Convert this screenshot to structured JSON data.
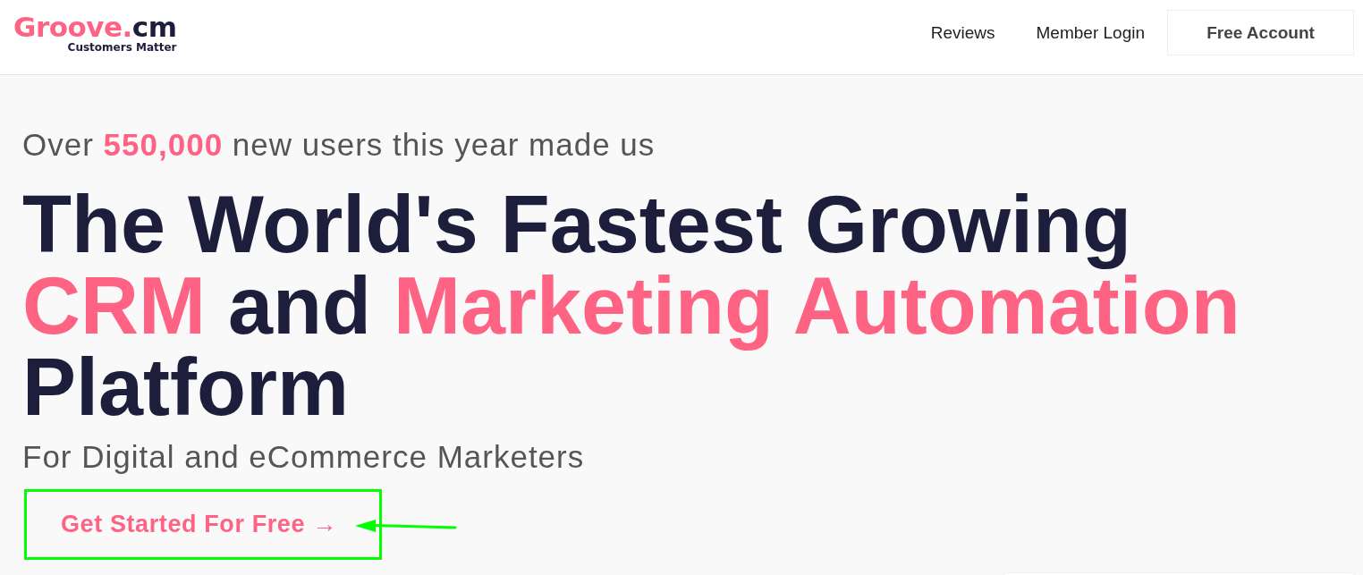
{
  "header": {
    "logo": {
      "wordmark": [
        {
          "text": "Groove.",
          "accent": true
        },
        {
          "text": "cm",
          "accent": false
        }
      ],
      "tagline": "Customers Matter"
    },
    "nav": [
      {
        "label": "Reviews",
        "kind": "link"
      },
      {
        "label": "Member Login",
        "kind": "link"
      },
      {
        "label": "Free Account",
        "kind": "button"
      }
    ]
  },
  "hero": {
    "intro": [
      {
        "text": "Over ",
        "accent": false
      },
      {
        "text": "550,000",
        "accent": true
      },
      {
        "text": " new users this year made us",
        "accent": false
      }
    ],
    "headline": [
      [
        {
          "text": "The World's Fastest Growing",
          "accent": false
        }
      ],
      [
        {
          "text": "CRM",
          "accent": true
        },
        {
          "text": " and ",
          "accent": false
        },
        {
          "text": "Marketing Automation",
          "accent": true
        }
      ],
      [
        {
          "text": "Platform",
          "accent": false
        }
      ]
    ],
    "subtitle": "For Digital and eCommerce Marketers",
    "cta": {
      "label": "Get Started For Free →",
      "highlighted": true
    }
  }
}
